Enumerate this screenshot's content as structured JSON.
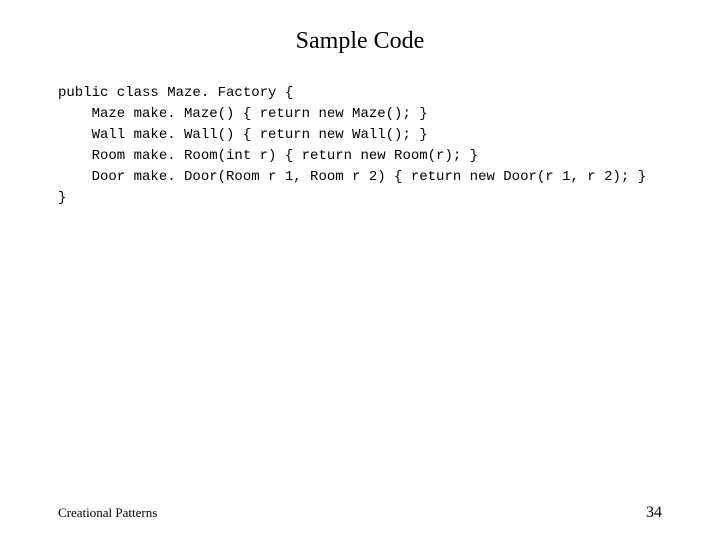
{
  "slide": {
    "title": "Sample Code",
    "code": {
      "line1": "public class Maze. Factory {",
      "line2": "    Maze make. Maze() { return new Maze(); }",
      "line3": "    Wall make. Wall() { return new Wall(); }",
      "line4": "    Room make. Room(int r) { return new Room(r); }",
      "line5": "    Door make. Door(Room r 1, Room r 2) { return new Door(r 1, r 2); }",
      "line6": "}"
    },
    "footer": {
      "left": "Creational Patterns",
      "right": "34"
    }
  }
}
